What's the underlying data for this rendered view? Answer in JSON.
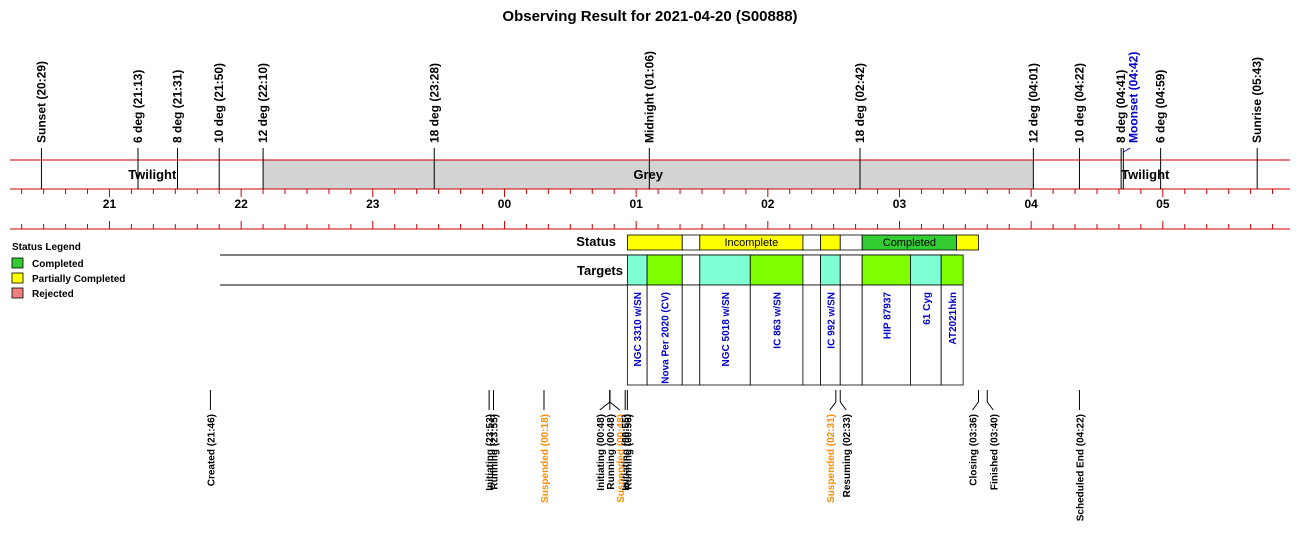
{
  "chart_data": {
    "type": "timeline",
    "title": "Observing Result for 2021-04-20 (S00888)",
    "x_range": [
      "20:10",
      "05:50"
    ],
    "colors": {
      "completed": "#33cc33",
      "partial": "#ffff00",
      "rejected": "#f08080",
      "target_a": "#7fffd4",
      "target_b": "#7fff00",
      "grey": "#d3d3d3",
      "axis": "#cc0000",
      "orange": "#ff8c00",
      "blue": "#0000cc"
    },
    "sky_events": [
      {
        "label": "Sunset (20:29)",
        "time": "20:29",
        "color": "#000000"
      },
      {
        "label": "6 deg (21:13)",
        "time": "21:13",
        "color": "#000000"
      },
      {
        "label": "8 deg (21:31)",
        "time": "21:31",
        "color": "#000000"
      },
      {
        "label": "10 deg (21:50)",
        "time": "21:50",
        "color": "#000000"
      },
      {
        "label": "12 deg (22:10)",
        "time": "22:10",
        "color": "#000000"
      },
      {
        "label": "18 deg (23:28)",
        "time": "23:28",
        "color": "#000000"
      },
      {
        "label": "Midnight (01:06)",
        "time": "01:06",
        "color": "#000000"
      },
      {
        "label": "18 deg (02:42)",
        "time": "02:42",
        "color": "#000000"
      },
      {
        "label": "12 deg (04:01)",
        "time": "04:01",
        "color": "#000000"
      },
      {
        "label": "10 deg (04:22)",
        "time": "04:22",
        "color": "#000000"
      },
      {
        "label": "8 deg (04:41)",
        "time": "04:41",
        "color": "#000000"
      },
      {
        "label": "Moonset (04:42)",
        "time": "04:42",
        "color": "#0000cc",
        "offset": 10
      },
      {
        "label": "6 deg (04:59)",
        "time": "04:59",
        "color": "#000000"
      },
      {
        "label": "Sunrise (05:43)",
        "time": "05:43",
        "color": "#000000"
      }
    ],
    "bands": [
      {
        "label": "Twilight",
        "start": "20:29",
        "end": "22:10",
        "fill": "#ffffff"
      },
      {
        "label": "Grey",
        "start": "22:10",
        "end": "04:01",
        "fill": "#d3d3d3"
      },
      {
        "label": "Twilight",
        "start": "04:01",
        "end": "05:43",
        "fill": "#ffffff"
      }
    ],
    "hour_labels": [
      "21",
      "22",
      "23",
      "00",
      "01",
      "02",
      "03",
      "04",
      "05"
    ],
    "row_labels": {
      "status": "Status",
      "targets": "Targets"
    },
    "status_segments": [
      {
        "start": "00:56",
        "end": "01:21",
        "fill": "#ffff00",
        "label": ""
      },
      {
        "start": "01:21",
        "end": "01:29",
        "fill": "#ffffff",
        "label": ""
      },
      {
        "start": "01:29",
        "end": "02:16",
        "fill": "#ffff00",
        "label": "Incomplete"
      },
      {
        "start": "02:16",
        "end": "02:24",
        "fill": "#ffffff",
        "label": ""
      },
      {
        "start": "02:24",
        "end": "02:33",
        "fill": "#ffff00",
        "label": ""
      },
      {
        "start": "02:33",
        "end": "02:43",
        "fill": "#ffffff",
        "label": ""
      },
      {
        "start": "02:43",
        "end": "03:26",
        "fill": "#33cc33",
        "label": "Completed"
      },
      {
        "start": "03:26",
        "end": "03:36",
        "fill": "#ffff00",
        "label": ""
      }
    ],
    "targets": [
      {
        "name": "NGC 3310 w/SN",
        "start": "00:56",
        "end": "01:05",
        "fill": "#7fffd4"
      },
      {
        "name": "Nova Per 2020 (CV)",
        "start": "01:05",
        "end": "01:21",
        "fill": "#7fff00"
      },
      {
        "name": "",
        "start": "01:21",
        "end": "01:29",
        "fill": "#ffffff"
      },
      {
        "name": "NGC 5018 w/SN",
        "start": "01:29",
        "end": "01:52",
        "fill": "#7fffd4"
      },
      {
        "name": "IC 863 w/SN",
        "start": "01:52",
        "end": "02:16",
        "fill": "#7fff00"
      },
      {
        "name": "",
        "start": "02:16",
        "end": "02:24",
        "fill": "#ffffff"
      },
      {
        "name": "IC 992 w/SN",
        "start": "02:24",
        "end": "02:33",
        "fill": "#7fffd4"
      },
      {
        "name": "",
        "start": "02:33",
        "end": "02:43",
        "fill": "#ffffff"
      },
      {
        "name": "HIP 87937",
        "start": "02:43",
        "end": "03:05",
        "fill": "#7fff00"
      },
      {
        "name": "61 Cyg",
        "start": "03:05",
        "end": "03:19",
        "fill": "#7fffd4"
      },
      {
        "name": "AT2021hkn",
        "start": "03:19",
        "end": "03:29",
        "fill": "#7fff00"
      }
    ],
    "status_events": [
      {
        "label": "Created (21:46)",
        "time": "21:46",
        "color": "#000000",
        "offset": 0
      },
      {
        "label": "Initiating (23:53)",
        "time": "23:53",
        "color": "#000000",
        "offset": 0
      },
      {
        "label": "Running (23:55)",
        "time": "23:55",
        "color": "#000000",
        "offset": 0
      },
      {
        "label": "Suspended (00:18)",
        "time": "00:18",
        "color": "#ff8c00",
        "offset": 0
      },
      {
        "label": "Initiating (00:48)",
        "time": "00:48",
        "color": "#000000",
        "offset": -10
      },
      {
        "label": "Running (00:48)",
        "time": "00:48",
        "color": "#000000",
        "offset": 0
      },
      {
        "label": "Suspended (00:48)",
        "time": "00:48",
        "color": "#ff8c00",
        "offset": 10
      },
      {
        "label": "Initiating (00:55)",
        "time": "00:55",
        "color": "#000000",
        "offset": 0
      },
      {
        "label": "Running (00:56)",
        "time": "00:56",
        "color": "#000000",
        "offset": 0
      },
      {
        "label": "Suspended (02:31)",
        "time": "02:31",
        "color": "#ff8c00",
        "offset": -6
      },
      {
        "label": "Resuming (02:33)",
        "time": "02:33",
        "color": "#000000",
        "offset": 6
      },
      {
        "label": "Closing (03:36)",
        "time": "03:36",
        "color": "#000000",
        "offset": -6
      },
      {
        "label": "Finished (03:40)",
        "time": "03:40",
        "color": "#000000",
        "offset": 6
      },
      {
        "label": "Scheduled End (04:22)",
        "time": "04:22",
        "color": "#000000",
        "offset": 0
      }
    ],
    "legend": {
      "title": "Status Legend",
      "items": [
        {
          "label": "Completed",
          "color": "#33cc33"
        },
        {
          "label": "Partially Completed",
          "color": "#ffff00"
        },
        {
          "label": "Rejected",
          "color": "#f08080"
        }
      ]
    }
  }
}
